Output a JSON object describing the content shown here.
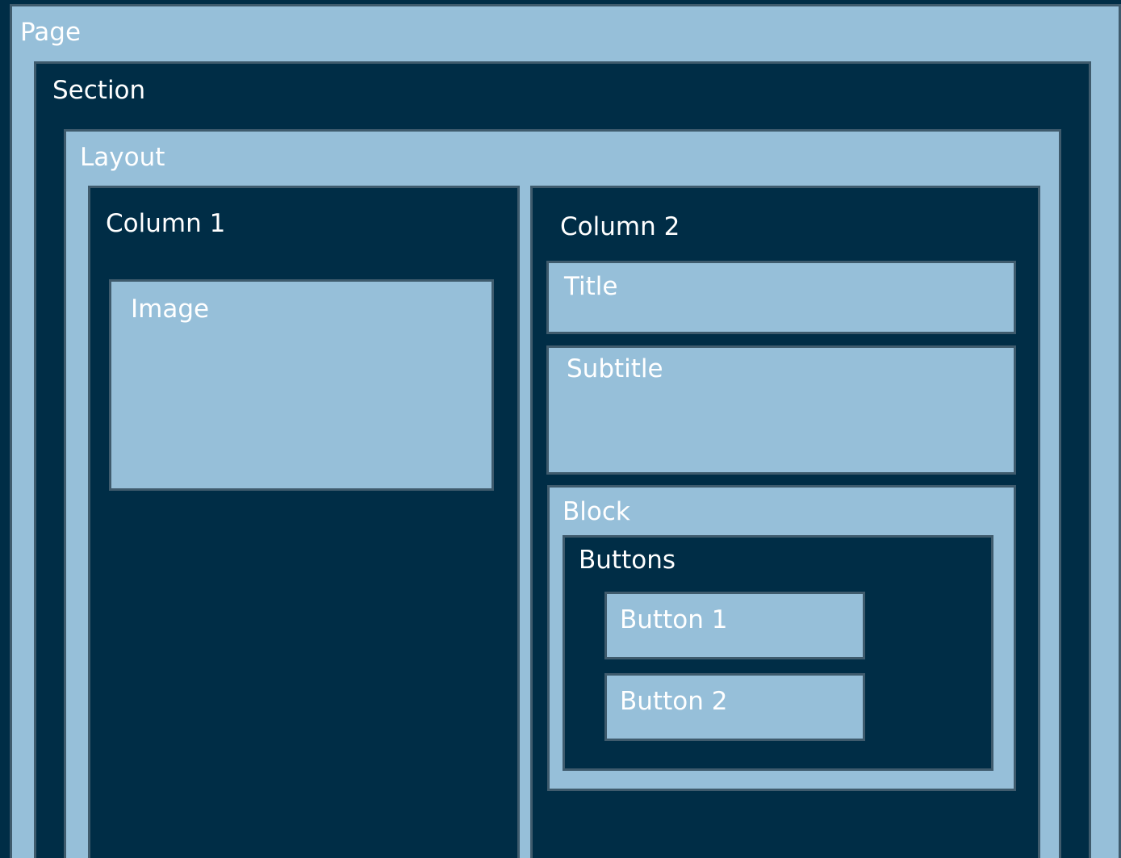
{
  "colors": {
    "light_fill": "#96bfd9",
    "dark_fill": "#002d46",
    "border": "#3f5b6d",
    "text": "#ffffff"
  },
  "page": {
    "label": "Page"
  },
  "section": {
    "label": "Section"
  },
  "layout": {
    "label": "Layout"
  },
  "column1": {
    "label": "Column 1",
    "image": {
      "label": "Image"
    }
  },
  "column2": {
    "label": "Column 2",
    "title": {
      "label": "Title"
    },
    "subtitle": {
      "label": "Subtitle"
    },
    "block": {
      "label": "Block",
      "buttons": {
        "label": "Buttons",
        "button1": {
          "label": "Button 1"
        },
        "button2": {
          "label": "Button 2"
        }
      }
    }
  }
}
